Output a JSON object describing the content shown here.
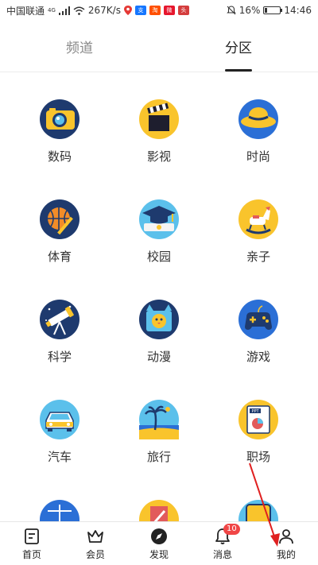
{
  "status_bar": {
    "carrier": "中国联通",
    "network_type": "4G",
    "speed": "267K/s",
    "battery": "16%",
    "battery_level": 0.16,
    "time": "14:46",
    "app_badges": [
      "支",
      "淘",
      "微",
      "头"
    ]
  },
  "tabs": [
    {
      "label": "频道",
      "active": false
    },
    {
      "label": "分区",
      "active": true
    }
  ],
  "categories": [
    {
      "label": "数码",
      "icon": "camera-icon"
    },
    {
      "label": "影视",
      "icon": "clapperboard-icon"
    },
    {
      "label": "时尚",
      "icon": "hat-icon"
    },
    {
      "label": "体育",
      "icon": "basketball-icon"
    },
    {
      "label": "校园",
      "icon": "graduation-cap-icon"
    },
    {
      "label": "亲子",
      "icon": "rocking-horse-icon"
    },
    {
      "label": "科学",
      "icon": "telescope-icon"
    },
    {
      "label": "动漫",
      "icon": "cartoon-cat-icon"
    },
    {
      "label": "游戏",
      "icon": "gamepad-icon"
    },
    {
      "label": "汽车",
      "icon": "car-icon"
    },
    {
      "label": "旅行",
      "icon": "palm-beach-icon"
    },
    {
      "label": "职场",
      "icon": "ppt-document-icon"
    }
  ],
  "bottom_nav": [
    {
      "label": "首页",
      "icon": "document-icon"
    },
    {
      "label": "会员",
      "icon": "crown-icon"
    },
    {
      "label": "发现",
      "icon": "compass-icon"
    },
    {
      "label": "消息",
      "icon": "bell-icon",
      "badge": "10"
    },
    {
      "label": "我的",
      "icon": "user-icon"
    }
  ],
  "colors": {
    "accent_yellow": "#F9C42C",
    "navy": "#1E3A6E",
    "badge_red": "#F04646",
    "annotation_red": "#E02020"
  }
}
